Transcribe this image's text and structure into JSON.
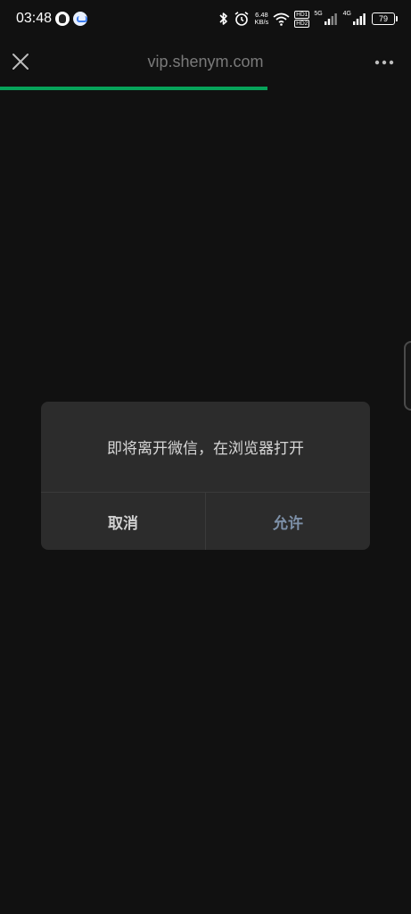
{
  "status_bar": {
    "time": "03:48",
    "net_speed_value": "6.48",
    "net_speed_unit": "KB/s",
    "hd1": "HD1",
    "hd2": "HD2",
    "sig1_label": "5G",
    "sig2_label": "4G",
    "battery_level": "79",
    "icons": [
      "qq-icon",
      "chat-app-icon",
      "bluetooth-icon",
      "alarm-icon",
      "wifi-icon",
      "signal-icon",
      "battery-icon"
    ]
  },
  "nav": {
    "title": "vip.shenym.com",
    "close_icon": "close-icon",
    "more_icon": "more-icon",
    "load_progress": 0.65,
    "progress_color": "#07a35a"
  },
  "dialog": {
    "message": "即将离开微信，在浏览器打开",
    "cancel_label": "取消",
    "allow_label": "允许"
  },
  "colors": {
    "background": "#111111",
    "dialog_bg": "#2c2c2c",
    "allow_text": "#7d90a8"
  }
}
